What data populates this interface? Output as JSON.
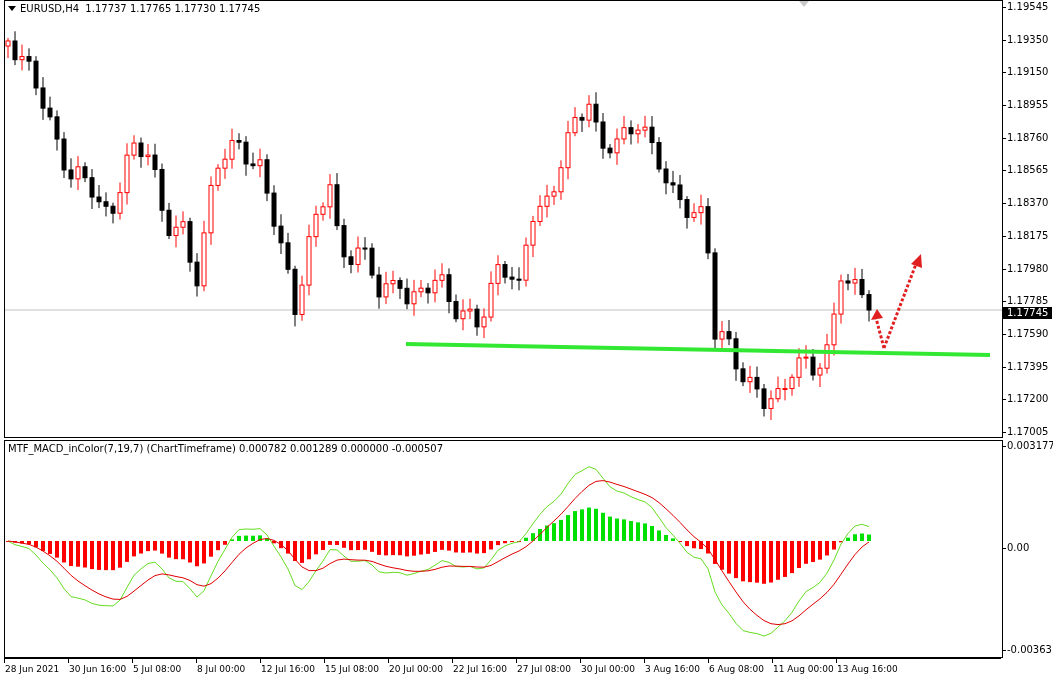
{
  "chart_header": {
    "text": "EURUSD,H4  1.17737 1.17765 1.17730 1.17745"
  },
  "price_axis": {
    "labels": [
      "1.19545",
      "1.19350",
      "1.19150",
      "1.18955",
      "1.18760",
      "1.18565",
      "1.18370",
      "1.18175",
      "1.17980",
      "1.17785",
      "1.17590",
      "1.17395",
      "1.17200",
      "1.17005"
    ],
    "current_price": "1.17745"
  },
  "indicator": {
    "header": "MTF_MACD_inColor(7,19,7) (ChartTimeframe) 0.000782 0.001289 0.000000 -0.000507",
    "axis_labels": [
      "0.003177",
      "0.00",
      "-0.00363"
    ]
  },
  "time_axis": {
    "labels": [
      "28 Jun 2021",
      "30 Jun 16:00",
      "5 Jul 08:00",
      "8 Jul 00:00",
      "12 Jul 16:00",
      "15 Jul 08:00",
      "20 Jul 00:00",
      "22 Jul 16:00",
      "27 Jul 08:00",
      "30 Jul 00:00",
      "3 Aug 16:00",
      "6 Aug 08:00",
      "11 Aug 00:00",
      "13 Aug 16:00"
    ]
  }
}
